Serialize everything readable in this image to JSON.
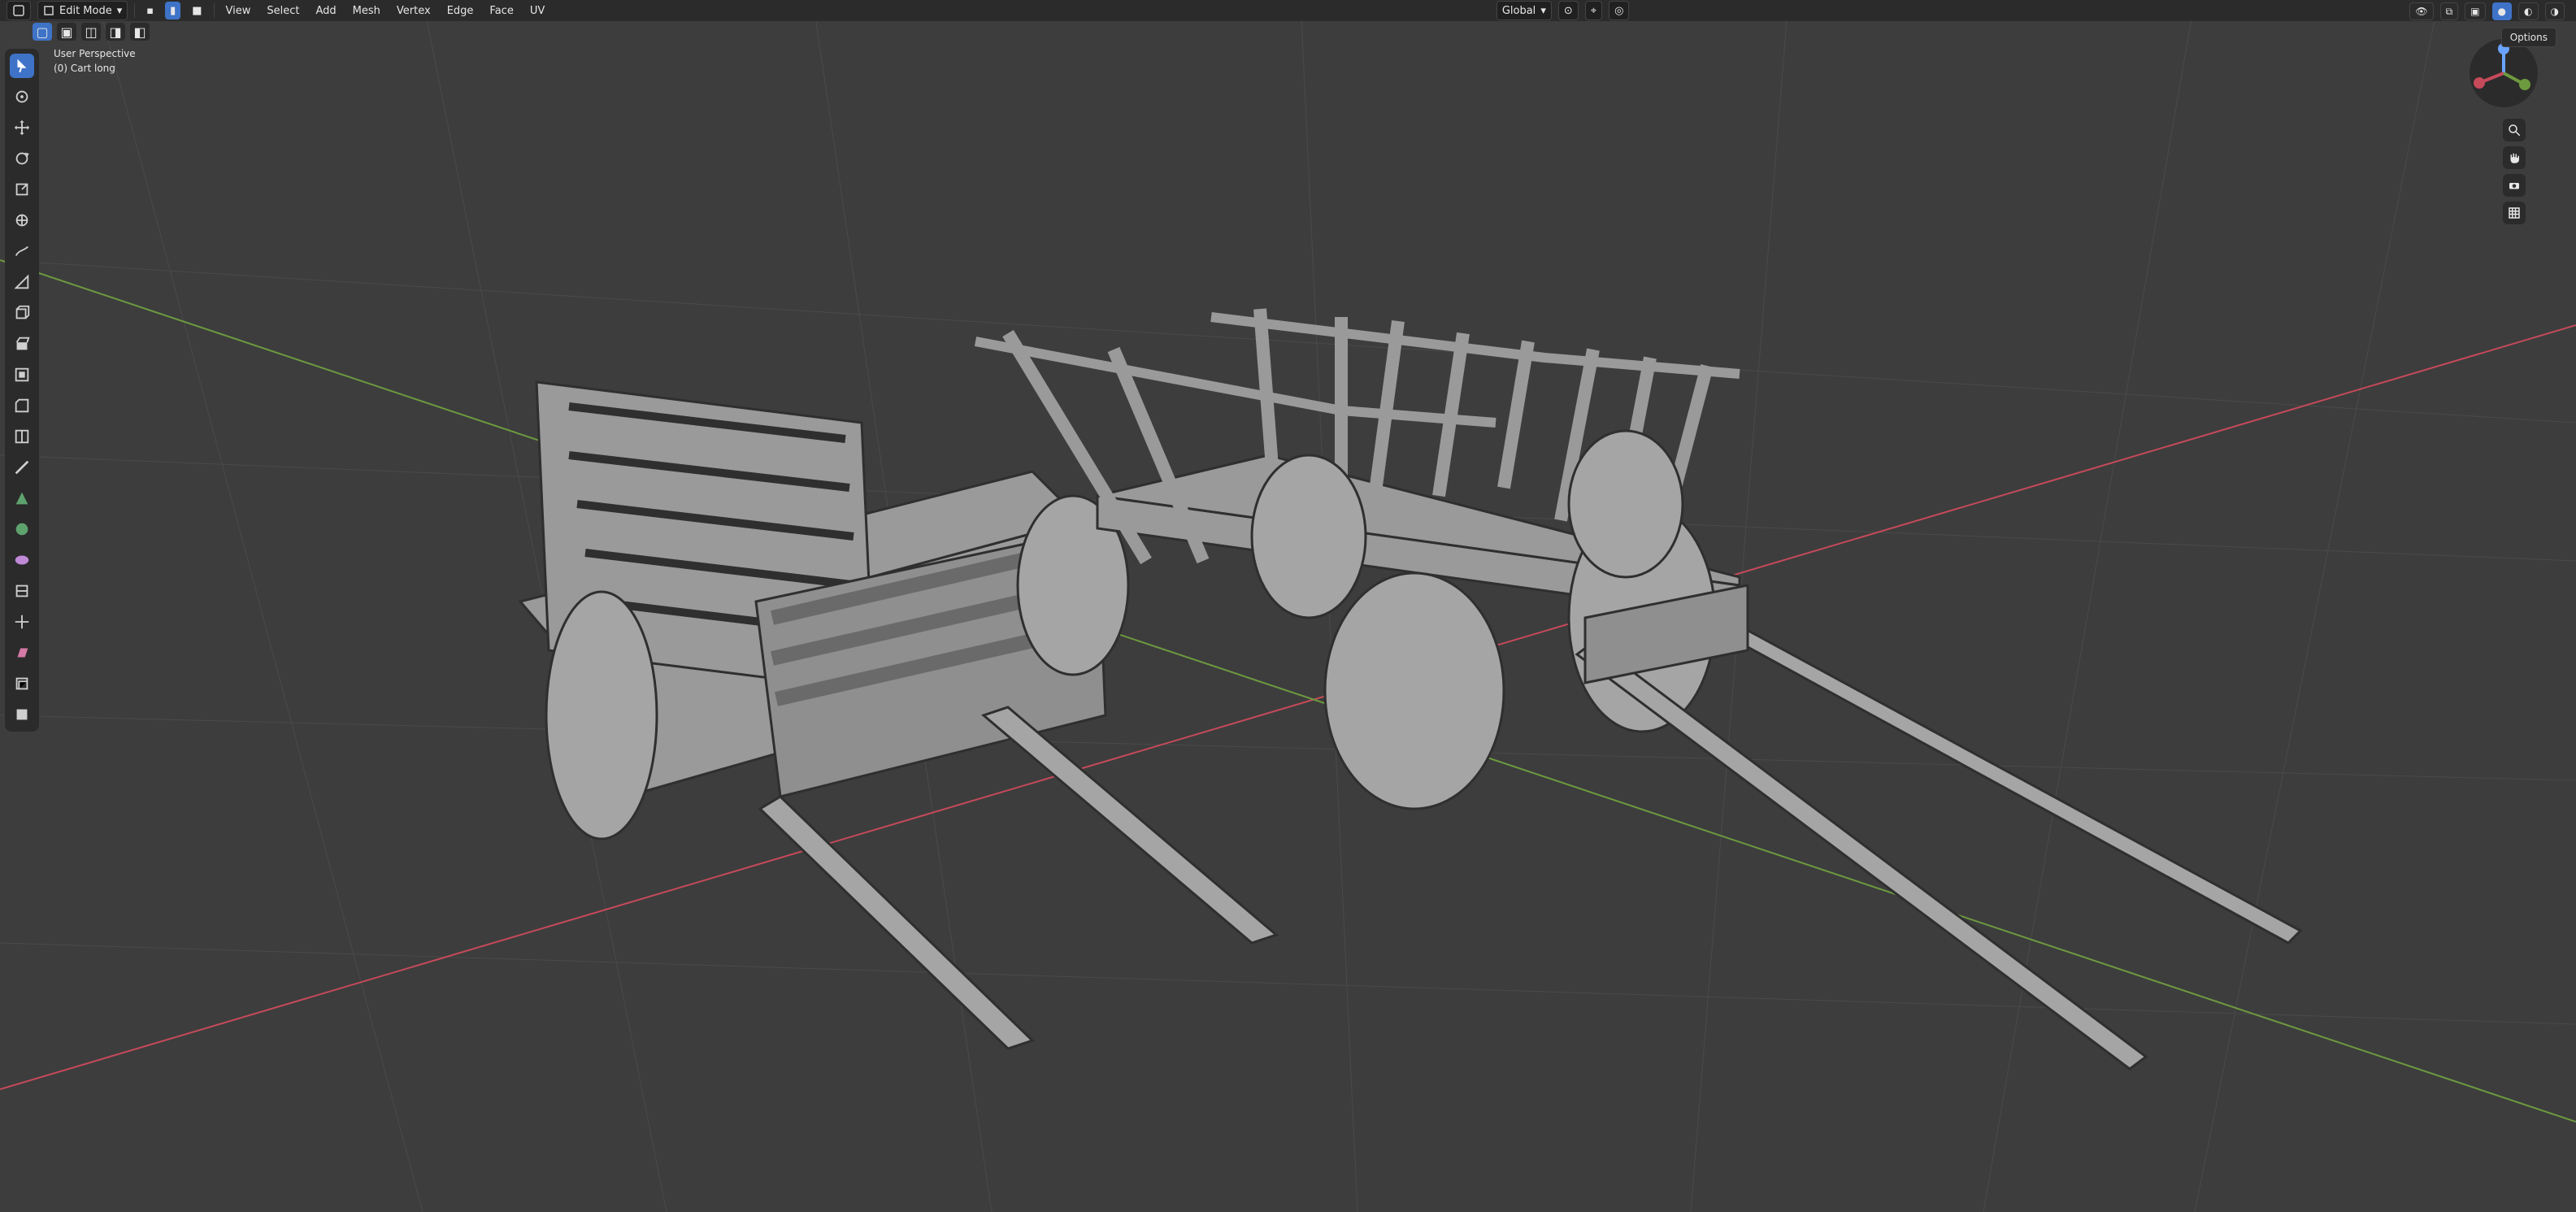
{
  "header": {
    "mode": "Edit Mode",
    "menus": [
      "View",
      "Select",
      "Add",
      "Mesh",
      "Vertex",
      "Edge",
      "Face",
      "UV"
    ],
    "transform_orientation": "Global"
  },
  "viewport": {
    "title": "User Perspective",
    "object_label": "(0) Cart long"
  },
  "right_header": {
    "options_label": "Options",
    "axis_labels": [
      "X",
      "Y",
      "Z"
    ]
  },
  "colors": {
    "accent": "#3e73c8",
    "grid_major": "#4a4a4a",
    "grid_minor": "#444444",
    "x_axis": "#c54a5a",
    "y_axis": "#6d9a3f"
  },
  "icons": {
    "toolbar": [
      "select-box-icon",
      "cursor-icon",
      "move-icon",
      "rotate-icon",
      "scale-icon",
      "transform-icon",
      "annotate-icon",
      "measure-icon",
      "add-cube-icon",
      "extrude-region-icon",
      "inset-faces-icon",
      "bevel-icon",
      "loop-cut-icon",
      "knife-icon",
      "poly-build-icon",
      "spin-icon",
      "smooth-icon",
      "edge-slide-icon",
      "shrink-fatten-icon",
      "shear-icon",
      "rip-region-icon",
      "face-set-icon"
    ],
    "nav": [
      "zoom-icon",
      "pan-hand-icon",
      "camera-icon",
      "grid-icon"
    ]
  }
}
